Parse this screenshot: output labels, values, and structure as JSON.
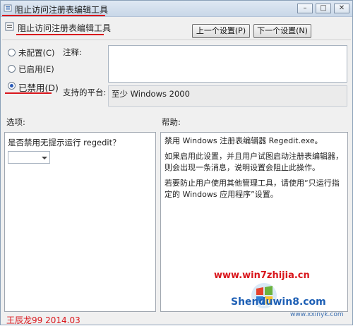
{
  "window": {
    "title": "阻止访问注册表编辑工具",
    "controls": {
      "minimize": "–",
      "maximize": "□",
      "close": "✕"
    }
  },
  "header": {
    "setting_name": "阻止访问注册表编辑工具",
    "prev_button": "上一个设置(P)",
    "next_button": "下一个设置(N)"
  },
  "state_options": [
    {
      "label": "未配置(C)",
      "selected": false
    },
    {
      "label": "已启用(E)",
      "selected": false
    },
    {
      "label": "已禁用(D)",
      "selected": true
    }
  ],
  "comment": {
    "label": "注释:",
    "value": ""
  },
  "supported": {
    "label": "支持的平台:",
    "value": "至少 Windows 2000"
  },
  "options": {
    "label": "选项:",
    "question": "是否禁用无提示运行 regedit？",
    "combo_value": ""
  },
  "help": {
    "label": "帮助:",
    "paragraphs": [
      "禁用 Windows 注册表编辑器 Regedit.exe。",
      "如果启用此设置，并且用户试图启动注册表编辑器，则会出现一条消息，说明设置会阻止此操作。",
      "若要防止用户使用其他管理工具，请使用“只运行指定的 Windows 应用程序”设置。"
    ]
  },
  "watermarks": {
    "url1": "www.win7zhijia.cn",
    "brand": "Shenduwin8.com",
    "url2": "www.xxinyk.com",
    "author": "王辰龙99 2014.03"
  },
  "colors": {
    "accent_red": "#d9161c",
    "title_bg": "#dfe8f3"
  }
}
